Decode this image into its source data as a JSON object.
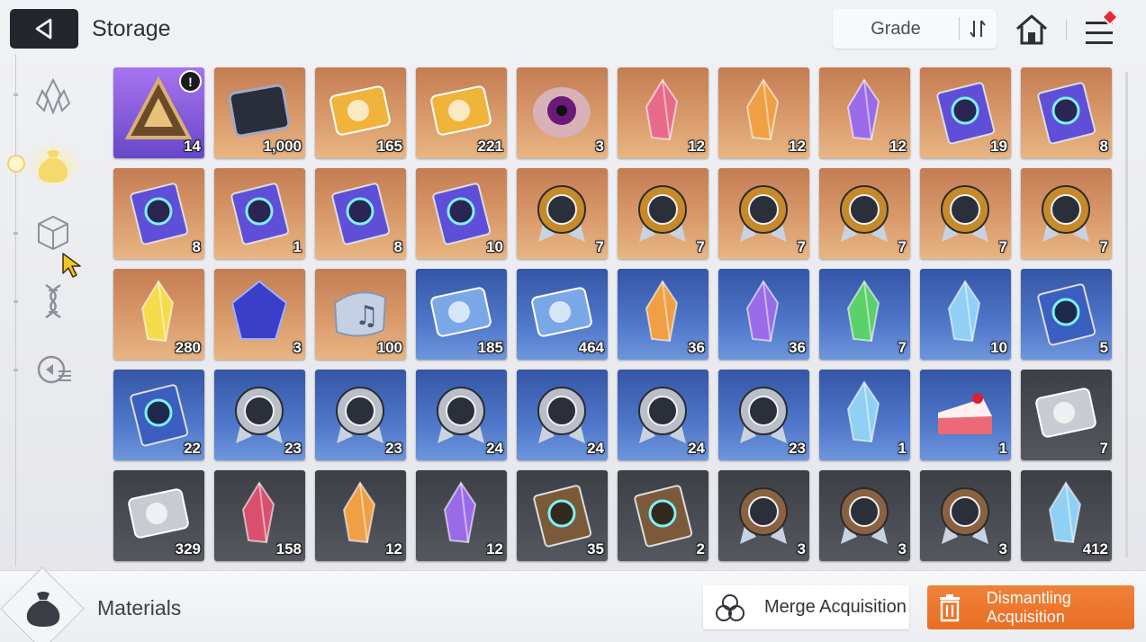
{
  "header": {
    "title": "Storage",
    "grade_label": "Grade",
    "back_icon": "back-arrow-icon",
    "sort_icon": "sort-icon",
    "home_icon": "home-icon",
    "menu_icon": "menu-icon"
  },
  "sidebar": {
    "items": [
      {
        "icon": "crystal-icon",
        "active": false
      },
      {
        "icon": "pouch-icon",
        "active": true
      },
      {
        "icon": "cube-icon",
        "active": false
      },
      {
        "icon": "dna-icon",
        "active": false
      },
      {
        "icon": "module-list-icon",
        "active": false
      }
    ]
  },
  "colors": {
    "purple": "#8a5ce0",
    "orange": "#d99a6b",
    "blue": "#4f77c9",
    "gray": "#4a4d53",
    "accent": "#ec7429",
    "back_button": "#23262c"
  },
  "items": [
    {
      "name": "triangle-module",
      "grade": "purple",
      "count": "14",
      "timer": true
    },
    {
      "name": "chip-plate",
      "grade": "orange",
      "count": "1,000"
    },
    {
      "name": "gold-ticket-portrait",
      "grade": "orange",
      "count": "165"
    },
    {
      "name": "gold-ticket-star",
      "grade": "orange",
      "count": "221"
    },
    {
      "name": "purple-eye-core",
      "grade": "orange",
      "count": "3"
    },
    {
      "name": "pink-crystal",
      "grade": "orange",
      "count": "12"
    },
    {
      "name": "amber-crystal",
      "grade": "orange",
      "count": "12"
    },
    {
      "name": "violet-crystal",
      "grade": "orange",
      "count": "12"
    },
    {
      "name": "book-cross",
      "grade": "orange",
      "count": "19"
    },
    {
      "name": "book-shield",
      "grade": "orange",
      "count": "8"
    },
    {
      "name": "book-eye",
      "grade": "orange",
      "count": "8"
    },
    {
      "name": "book-wing",
      "grade": "orange",
      "count": "1"
    },
    {
      "name": "book-bolt",
      "grade": "orange",
      "count": "8"
    },
    {
      "name": "book-orbit",
      "grade": "orange",
      "count": "10"
    },
    {
      "name": "gold-medal-sword",
      "grade": "orange",
      "count": "7"
    },
    {
      "name": "gold-medal-shield",
      "grade": "orange",
      "count": "7"
    },
    {
      "name": "gold-medal-target",
      "grade": "orange",
      "count": "7"
    },
    {
      "name": "gold-medal-wing",
      "grade": "orange",
      "count": "7"
    },
    {
      "name": "gold-medal-bolt",
      "grade": "orange",
      "count": "7"
    },
    {
      "name": "gold-medal-orbit",
      "grade": "orange",
      "count": "7"
    },
    {
      "name": "yellow-shards",
      "grade": "orange",
      "count": "280"
    },
    {
      "name": "blue-cube-gem",
      "grade": "orange",
      "count": "3"
    },
    {
      "name": "music-scroll",
      "grade": "orange",
      "count": "100"
    },
    {
      "name": "silver-ticket-portrait",
      "grade": "blue",
      "count": "185"
    },
    {
      "name": "silver-ticket-star",
      "grade": "blue",
      "count": "464"
    },
    {
      "name": "orange-crystal",
      "grade": "blue",
      "count": "36"
    },
    {
      "name": "purple-crystal",
      "grade": "blue",
      "count": "36"
    },
    {
      "name": "green-crystal",
      "grade": "blue",
      "count": "7"
    },
    {
      "name": "ice-crystal",
      "grade": "blue",
      "count": "10"
    },
    {
      "name": "blue-book-shield",
      "grade": "blue",
      "count": "5"
    },
    {
      "name": "blue-book-bolt",
      "grade": "blue",
      "count": "22"
    },
    {
      "name": "silver-medal-sword",
      "grade": "blue",
      "count": "23"
    },
    {
      "name": "silver-medal-shield",
      "grade": "blue",
      "count": "23"
    },
    {
      "name": "silver-medal-target",
      "grade": "blue",
      "count": "24"
    },
    {
      "name": "silver-medal-wing",
      "grade": "blue",
      "count": "24"
    },
    {
      "name": "silver-medal-bolt",
      "grade": "blue",
      "count": "24"
    },
    {
      "name": "silver-medal-orbit",
      "grade": "blue",
      "count": "23"
    },
    {
      "name": "ice-shard-cluster",
      "grade": "blue",
      "count": "1"
    },
    {
      "name": "strawberry-cake",
      "grade": "blue",
      "count": "1"
    },
    {
      "name": "gray-ticket-portrait",
      "grade": "gray",
      "count": "7"
    },
    {
      "name": "gray-ticket-star",
      "grade": "gray",
      "count": "329"
    },
    {
      "name": "red-shard",
      "grade": "gray",
      "count": "158"
    },
    {
      "name": "orange-shard",
      "grade": "gray",
      "count": "12"
    },
    {
      "name": "purple-shard",
      "grade": "gray",
      "count": "12"
    },
    {
      "name": "bronze-book-cross",
      "grade": "gray",
      "count": "35"
    },
    {
      "name": "bronze-book-bolt",
      "grade": "gray",
      "count": "2"
    },
    {
      "name": "bronze-medal-target",
      "grade": "gray",
      "count": "3"
    },
    {
      "name": "bronze-medal-wing",
      "grade": "gray",
      "count": "3"
    },
    {
      "name": "bronze-medal-bolt",
      "grade": "gray",
      "count": "3"
    },
    {
      "name": "blue-crystal-chunk",
      "grade": "gray",
      "count": "412"
    }
  ],
  "footer": {
    "category_label": "Materials",
    "category_icon": "pouch-icon",
    "merge_label": "Merge Acquisition",
    "merge_icon": "merge-icon",
    "dismantle_label": "Dismantling Acquisition",
    "dismantle_icon": "trash-icon"
  }
}
